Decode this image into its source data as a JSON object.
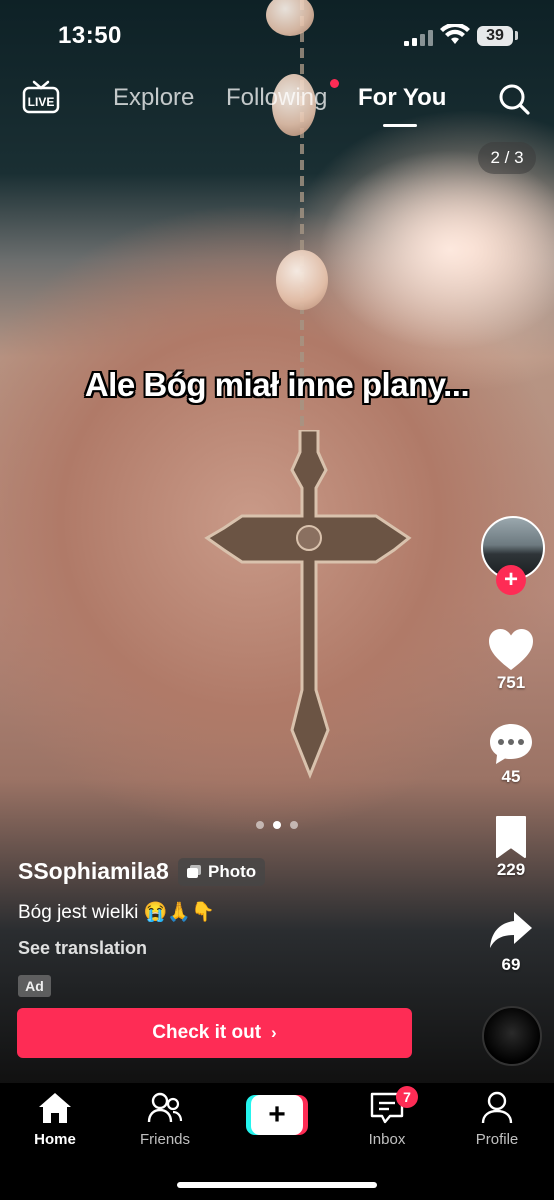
{
  "status_bar": {
    "time": "13:50",
    "battery": "39"
  },
  "top_nav": {
    "tabs": [
      {
        "label": "Explore",
        "active": false
      },
      {
        "label": "Following",
        "active": false,
        "has_dot": true
      },
      {
        "label": "For You",
        "active": true
      }
    ]
  },
  "post": {
    "page_counter": "2 / 3",
    "overlay_text": "Ale Bóg miał inne plany...",
    "username": "SSophiamila8",
    "badge": "Photo",
    "caption": "Bóg jest wielki 😭🙏👇",
    "see_translation": "See translation",
    "ad_label": "Ad",
    "cta": "Check it out",
    "carousel": {
      "total": 3,
      "active_index": 1
    }
  },
  "actions": {
    "likes": "751",
    "comments": "45",
    "saves": "229",
    "shares": "69"
  },
  "bottom_nav": {
    "items": [
      {
        "label": "Home",
        "active": true
      },
      {
        "label": "Friends",
        "active": false
      },
      {
        "label": "Inbox",
        "active": false,
        "badge": "7"
      },
      {
        "label": "Profile",
        "active": false
      }
    ]
  },
  "colors": {
    "accent": "#fe2c55",
    "cyan": "#25f4ee"
  }
}
